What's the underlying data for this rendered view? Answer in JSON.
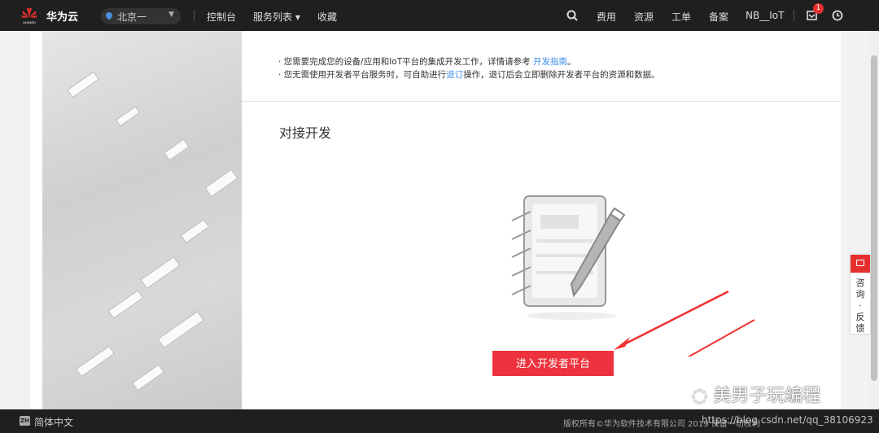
{
  "header": {
    "brand": "华为云",
    "logo_text": "HUAWEI",
    "region": "北京一",
    "nav": [
      "控制台",
      "服务列表 ▾",
      "收藏"
    ],
    "right": [
      "费用",
      "资源",
      "工单",
      "备案",
      "NB__IoT"
    ],
    "notification_count": "1"
  },
  "notice": {
    "line1_prefix": "· 您需要完成您的设备/应用和IoT平台的集成开发工作，详情请参考 ",
    "line1_link": "开发指南",
    "line1_suffix": "。",
    "line2_prefix": "· 您无需使用开发者平台服务时，可自助进行",
    "line2_link": "退订",
    "line2_suffix": "操作，退订后会立即删除开发者平台的资源和数据。"
  },
  "section_title": "对接开发",
  "enter_button": "进入开发者平台",
  "feedback": "咨询·反馈",
  "footer": {
    "lang_badge": "ZH",
    "lang": "简体中文",
    "copyright": "版权所有©华为软件技术有限公司 2019 保留一切权利",
    "url_watermark": "https://blog.csdn.net/qq_38106923"
  },
  "watermark": "美男子玩编程",
  "colors": {
    "accent": "#ec323d",
    "link": "#3b8beb",
    "topbar": "#1f1f1f"
  }
}
